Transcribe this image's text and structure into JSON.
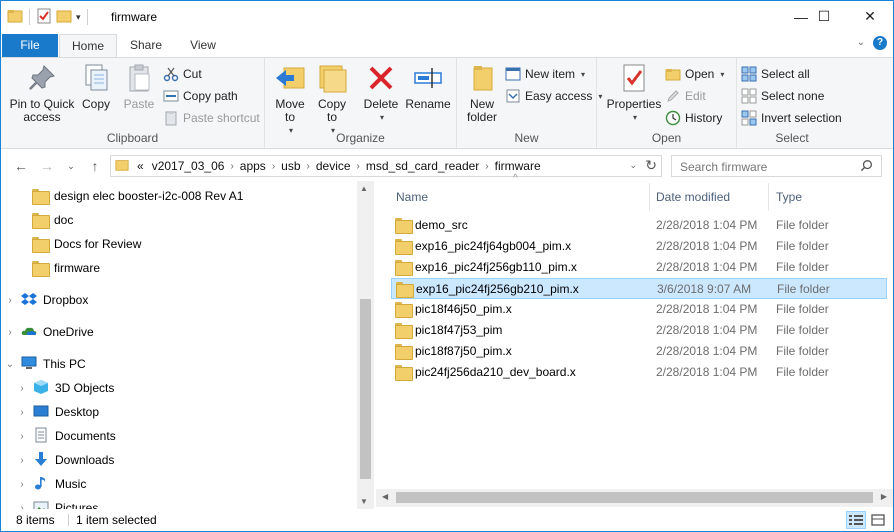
{
  "window": {
    "title": "firmware",
    "minimize_glyph": "—",
    "maximize_glyph": "☐",
    "close_glyph": "✕"
  },
  "ribbon_tabs": {
    "file": "File",
    "home": "Home",
    "share": "Share",
    "view": "View"
  },
  "ribbon": {
    "clipboard": {
      "label": "Clipboard",
      "pin": "Pin to Quick access",
      "copy": "Copy",
      "paste": "Paste",
      "cut": "Cut",
      "copy_path": "Copy path",
      "paste_shortcut": "Paste shortcut"
    },
    "organize": {
      "label": "Organize",
      "move_to": "Move to",
      "copy_to": "Copy to",
      "delete": "Delete",
      "rename": "Rename"
    },
    "new": {
      "label": "New",
      "new_folder": "New folder",
      "new_item": "New item",
      "easy_access": "Easy access"
    },
    "open": {
      "label": "Open",
      "properties": "Properties",
      "open": "Open",
      "edit": "Edit",
      "history": "History"
    },
    "select": {
      "label": "Select",
      "select_all": "Select all",
      "select_none": "Select none",
      "invert_selection": "Invert selection"
    }
  },
  "address": {
    "overflow": "«",
    "crumbs": [
      "v2017_03_06",
      "apps",
      "usb",
      "device",
      "msd_sd_card_reader",
      "firmware"
    ],
    "search_placeholder": "Search firmware"
  },
  "nav_pane": {
    "items": [
      {
        "label": "design elec booster-i2c-008 Rev A1",
        "icon": "folder-icon"
      },
      {
        "label": "doc",
        "icon": "folder-icon"
      },
      {
        "label": "Docs for Review",
        "icon": "folder-icon"
      },
      {
        "label": "firmware",
        "icon": "folder-icon"
      },
      {
        "label": "Dropbox",
        "icon": "dropbox-icon"
      },
      {
        "label": "OneDrive",
        "icon": "onedrive-icon"
      },
      {
        "label": "This PC",
        "icon": "this-pc-icon"
      },
      {
        "label": "3D Objects",
        "icon": "3d-objects-icon"
      },
      {
        "label": "Desktop",
        "icon": "desktop-icon"
      },
      {
        "label": "Documents",
        "icon": "documents-icon"
      },
      {
        "label": "Downloads",
        "icon": "downloads-icon"
      },
      {
        "label": "Music",
        "icon": "music-icon"
      },
      {
        "label": "Pictures",
        "icon": "pictures-icon"
      }
    ]
  },
  "file_list": {
    "columns": {
      "name": "Name",
      "date": "Date modified",
      "type": "Type"
    },
    "rows": [
      {
        "name": "demo_src",
        "date": "2/28/2018 1:04 PM",
        "type": "File folder",
        "selected": false
      },
      {
        "name": "exp16_pic24fj64gb004_pim.x",
        "date": "2/28/2018 1:04 PM",
        "type": "File folder",
        "selected": false
      },
      {
        "name": "exp16_pic24fj256gb110_pim.x",
        "date": "2/28/2018 1:04 PM",
        "type": "File folder",
        "selected": false
      },
      {
        "name": "exp16_pic24fj256gb210_pim.x",
        "date": "3/6/2018 9:07 AM",
        "type": "File folder",
        "selected": true
      },
      {
        "name": "pic18f46j50_pim.x",
        "date": "2/28/2018 1:04 PM",
        "type": "File folder",
        "selected": false
      },
      {
        "name": "pic18f47j53_pim",
        "date": "2/28/2018 1:04 PM",
        "type": "File folder",
        "selected": false
      },
      {
        "name": "pic18f87j50_pim.x",
        "date": "2/28/2018 1:04 PM",
        "type": "File folder",
        "selected": false
      },
      {
        "name": "pic24fj256da210_dev_board.x",
        "date": "2/28/2018 1:04 PM",
        "type": "File folder",
        "selected": false
      }
    ]
  },
  "status": {
    "item_count": "8 items",
    "selection": "1 item selected"
  },
  "colors": {
    "accent": "#1979ca",
    "selection_bg": "#cce8ff",
    "selection_border": "#99d1ff",
    "folder": "#f3cf6b"
  }
}
